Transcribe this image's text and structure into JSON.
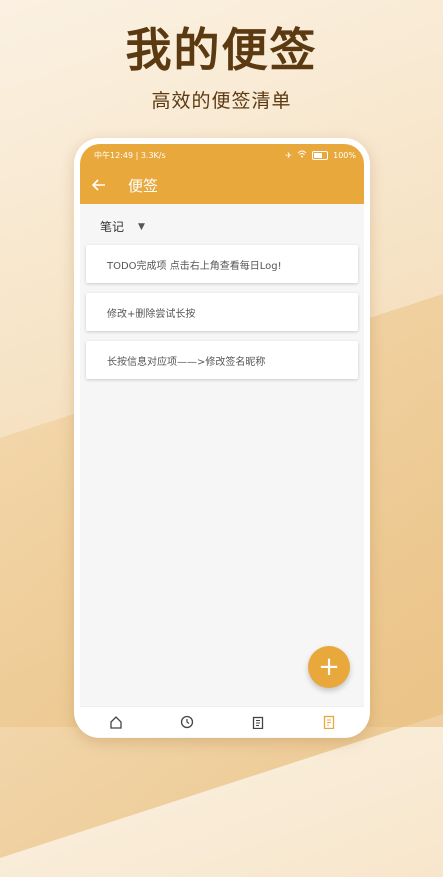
{
  "promo": {
    "headline": "我的便签",
    "subheadline": "高效的便签清单"
  },
  "statusbar": {
    "time_speed": "中午12:49 | 3.3K/s",
    "battery": "100%"
  },
  "appbar": {
    "back_icon": "arrow-left-icon",
    "title": "便签"
  },
  "category": {
    "selected": "笔记"
  },
  "notes": [
    "TODO完成项 点击右上角查看每日Log!",
    "修改+删除尝试长按",
    "长按信息对应项——>修改签名昵称"
  ],
  "fab": {
    "label": "+"
  },
  "bottom_nav": [
    "home-icon",
    "clock-icon",
    "clipboard-icon",
    "note-icon"
  ],
  "colors": {
    "accent": "#e8a83c",
    "headline": "#5b3a12"
  }
}
